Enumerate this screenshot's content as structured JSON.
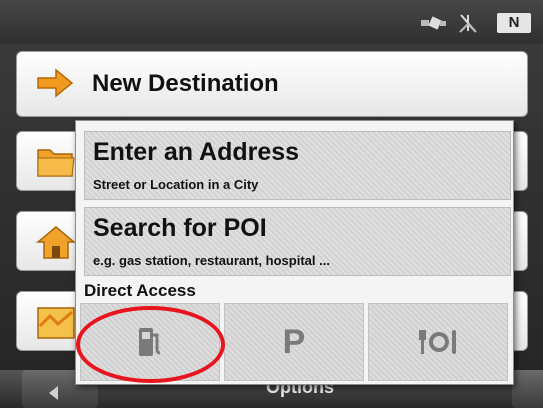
{
  "status_bar": {
    "compass": "N"
  },
  "menu": {
    "new_destination": "New Destination"
  },
  "popup": {
    "enter_address": {
      "title": "Enter an Address",
      "subtitle": "Street or Location in a City"
    },
    "search_poi": {
      "title": "Search for POI",
      "subtitle": "e.g. gas station, restaurant, hospital ..."
    },
    "direct_access": {
      "label": "Direct Access",
      "tiles": [
        {
          "icon": "fuel-pump-icon"
        },
        {
          "icon": "parking-icon",
          "text": "P"
        },
        {
          "icon": "restaurant-icon"
        }
      ]
    }
  },
  "bottom_bar": {
    "options_label": "Options"
  },
  "colors": {
    "highlight": "#e8141e",
    "arrow": "#f29a1f"
  }
}
